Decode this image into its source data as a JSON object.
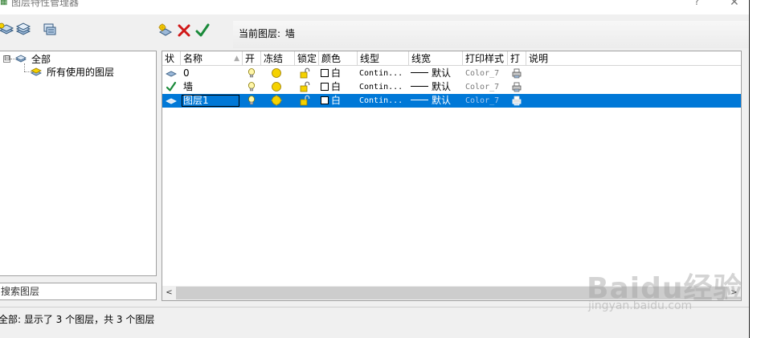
{
  "window": {
    "title": "图层特性管理器",
    "help_label": "?",
    "close_label": "✕"
  },
  "toolbar": {
    "current_layer_label": "当前图层:",
    "current_layer_value": "墙",
    "icons": [
      "new-layer-properties-filter-icon",
      "new-layer-group-filter-icon",
      "layer-states-manager-icon",
      "new-layer-icon",
      "delete-layer-icon",
      "set-current-icon"
    ]
  },
  "tree": {
    "root": {
      "label": "全部",
      "expander": "⊟"
    },
    "children": [
      {
        "label": "所有使用的图层"
      }
    ]
  },
  "search": {
    "placeholder": "搜索图层"
  },
  "list": {
    "columns": [
      "状",
      "名称",
      "开",
      "冻结",
      "锁定",
      "颜色",
      "线型",
      "线宽",
      "打印样式",
      "打",
      "说明"
    ],
    "rows": [
      {
        "status_icon": "layer-icon",
        "name": "0",
        "on": "on",
        "freeze": "thawed",
        "lock": "unlocked",
        "color_name": "白",
        "linetype": "Contin...",
        "lineweight": "默认",
        "plot_style": "Color_7",
        "plot": "plot-icon",
        "description": ""
      },
      {
        "status_icon": "current-check-icon",
        "name": "墙",
        "on": "on",
        "freeze": "thawed",
        "lock": "unlocked",
        "color_name": "白",
        "linetype": "Contin...",
        "lineweight": "默认",
        "plot_style": "Color_7",
        "plot": "plot-icon",
        "description": ""
      },
      {
        "status_icon": "layer-icon",
        "name": "图层1",
        "on": "on",
        "freeze": "thawed",
        "lock": "unlocked",
        "color_name": "白",
        "linetype": "Contin...",
        "lineweight": "默认",
        "plot_style": "Color_7",
        "plot": "plot-icon",
        "description": "",
        "selected": true
      }
    ]
  },
  "scrollbar": {
    "left_arrow": "<",
    "right_arrow": ">"
  },
  "status": {
    "text": "全部: 显示了 3 个图层，共 3 个图层"
  },
  "watermark": {
    "main": "Baidu经验",
    "sub": "jingyan.baidu.com"
  },
  "colors": {
    "selection": "#0078d7",
    "accent_yellow": "#f5d200",
    "check_green": "#1a8a3a",
    "delete_red": "#d01818"
  }
}
